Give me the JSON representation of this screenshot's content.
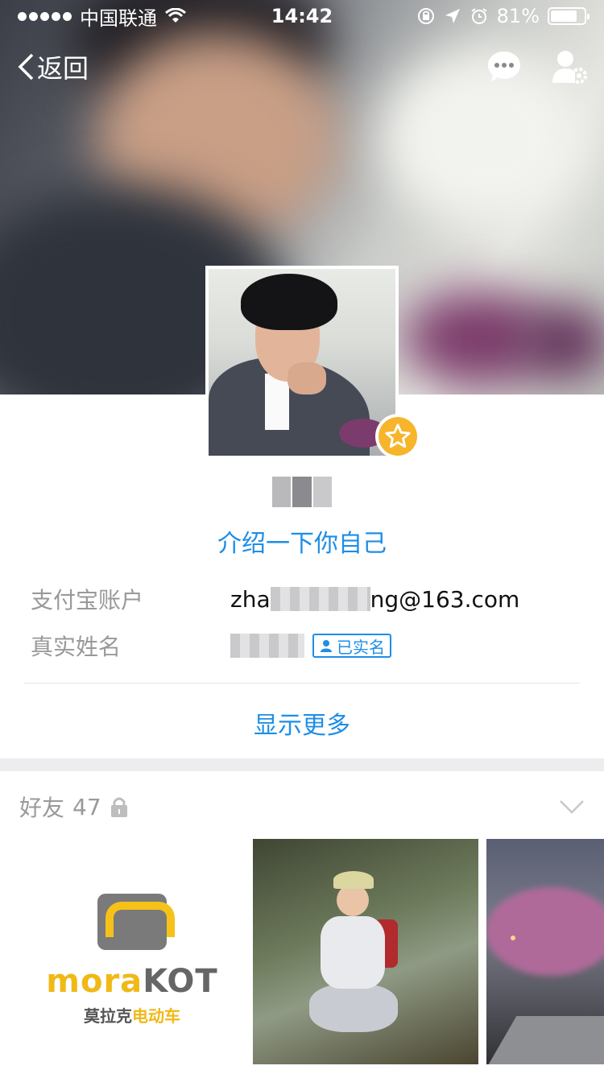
{
  "status_bar": {
    "carrier": "中国联通",
    "time": "14:42",
    "battery_percent": "81%",
    "battery_level": 0.81
  },
  "nav": {
    "back_label": "返回",
    "icons": [
      "chat-bubble-icon",
      "user-settings-icon"
    ]
  },
  "profile": {
    "intro_link": "介绍一下你自己",
    "alipay_label": "支付宝账户",
    "alipay_value_prefix": "zha",
    "alipay_value_suffix": "ng@163.com",
    "realname_label": "真实姓名",
    "verified_label": "已实名",
    "show_more": "显示更多"
  },
  "friends": {
    "label": "好友",
    "count": "47",
    "logo_thumb": {
      "brand_main": "mora",
      "brand_tail": "KOT",
      "cn_main": "莫拉克",
      "cn_tail": "电动车"
    }
  },
  "colors": {
    "accent": "#1e8ee6",
    "badge": "#f6b52b",
    "muted": "#999999"
  }
}
